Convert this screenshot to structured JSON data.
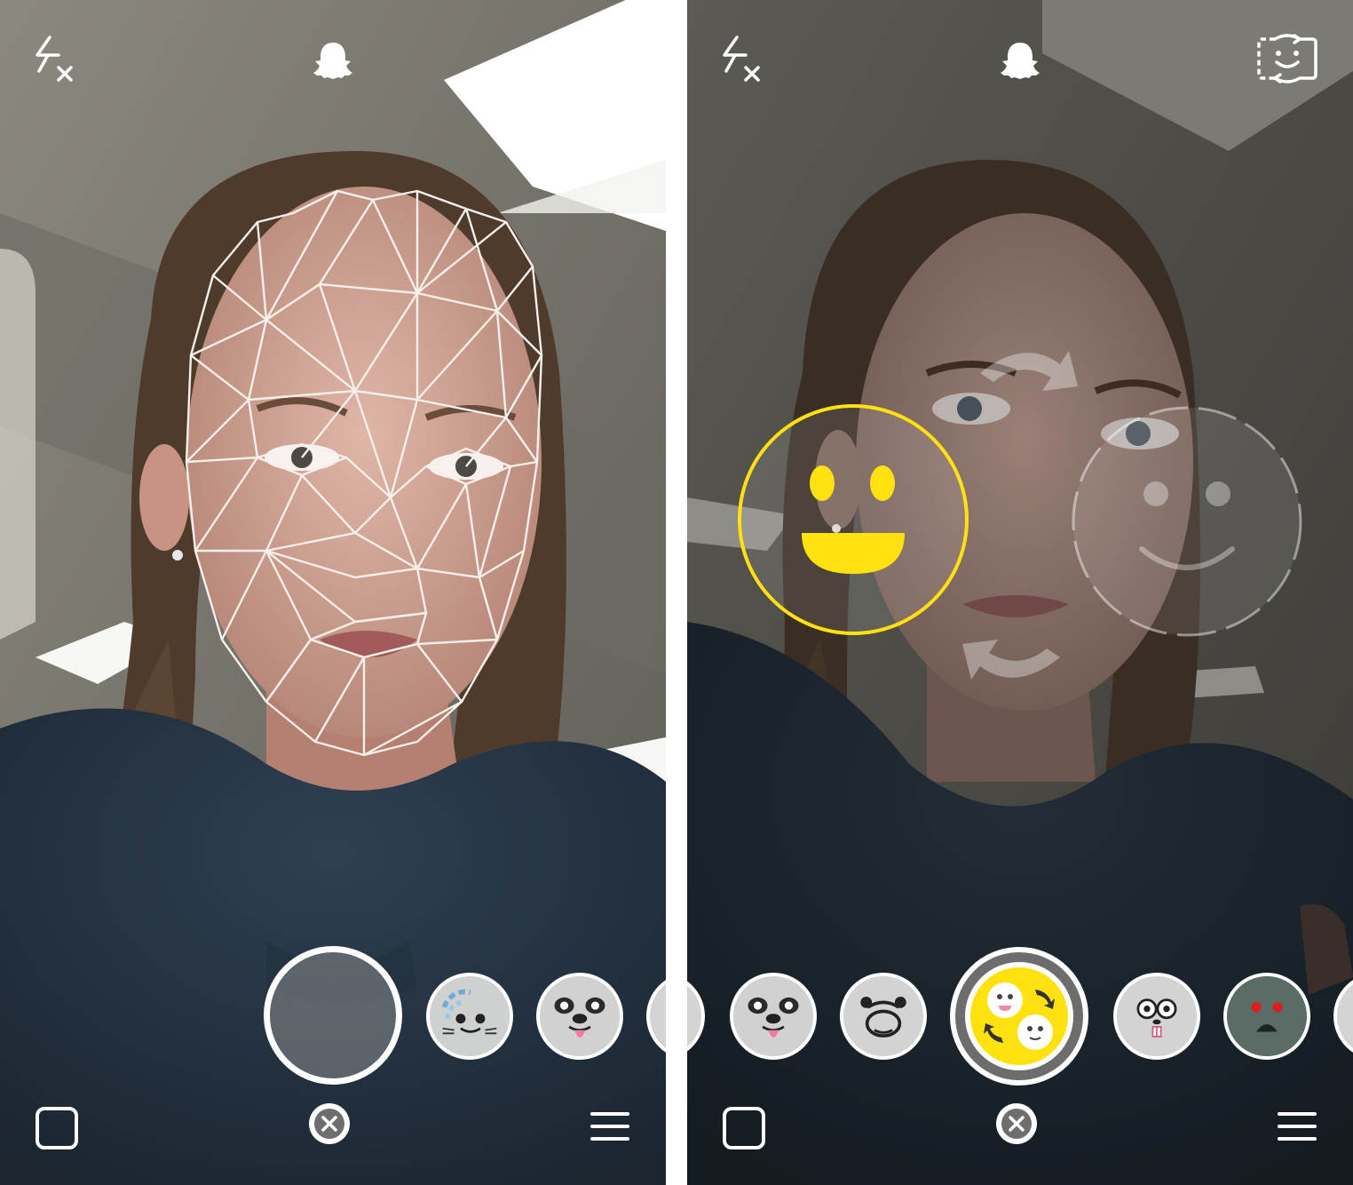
{
  "left_screen": {
    "top_bar": {
      "flash_icon": "flash-off-icon",
      "ghost_icon": "snapchat-ghost-icon",
      "face_swap_icon": "face-swap-icon"
    },
    "overlay": "face-mesh",
    "lenses": [
      "blue-dash-face",
      "dog-face",
      "partial-lens"
    ],
    "bottom_bar": {
      "memories_icon": "memories-square-icon",
      "close_icon": "close-x-icon",
      "menu_icon": "hamburger-menu-icon"
    }
  },
  "right_screen": {
    "top_bar": {
      "flash_icon": "flash-off-icon",
      "ghost_icon": "snapchat-ghost-icon",
      "face_swap_icon": "face-swap-icon"
    },
    "overlay": "face-swap-guide",
    "lenses": [
      "partial-lens",
      "dog-face",
      "bear-face",
      "face-swap",
      "bunny-face",
      "zombie-face",
      "partial-lens"
    ],
    "selected_lens": "face-swap",
    "bottom_bar": {
      "memories_icon": "memories-square-icon",
      "close_icon": "close-x-icon",
      "menu_icon": "hamburger-menu-icon"
    }
  },
  "colors": {
    "accent_yellow": "#FFE110",
    "ui_white": "#FFFFFF",
    "mesh_line": "#F6EFEA"
  }
}
